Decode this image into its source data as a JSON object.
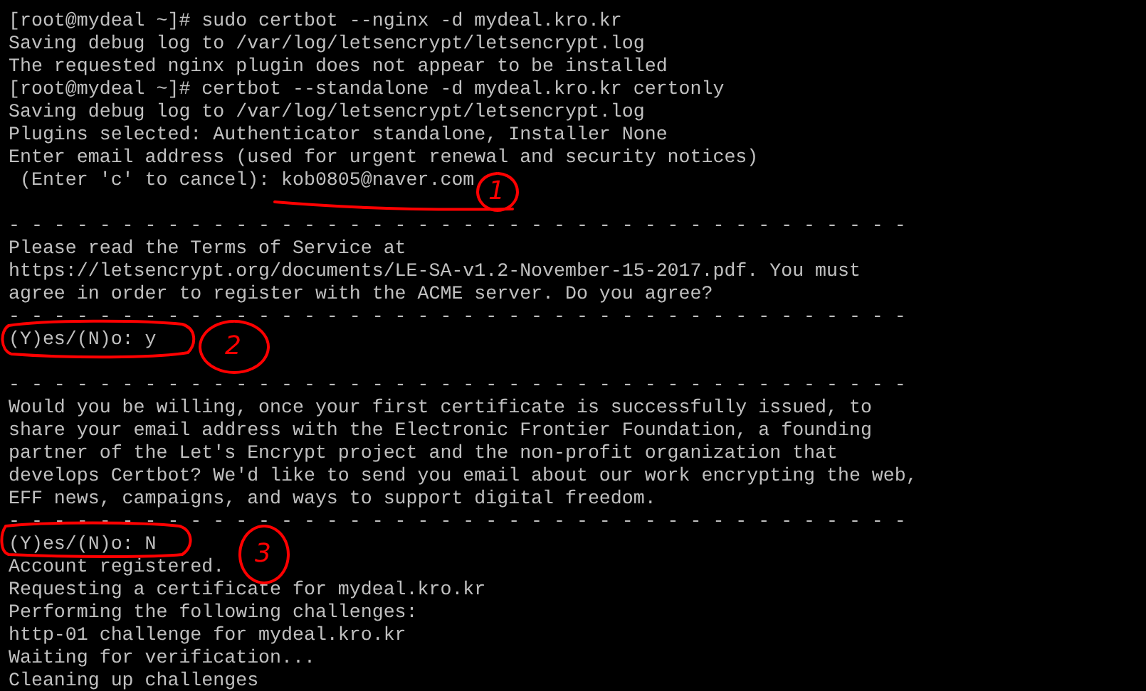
{
  "terminal": {
    "lines": [
      {
        "kind": "text",
        "text": "[root@mydeal ~]# sudo certbot --nginx -d mydeal.kro.kr"
      },
      {
        "kind": "text",
        "text": "Saving debug log to /var/log/letsencrypt/letsencrypt.log"
      },
      {
        "kind": "text",
        "text": "The requested nginx plugin does not appear to be installed"
      },
      {
        "kind": "text",
        "text": "[root@mydeal ~]# certbot --standalone -d mydeal.kro.kr certonly"
      },
      {
        "kind": "text",
        "text": "Saving debug log to /var/log/letsencrypt/letsencrypt.log"
      },
      {
        "kind": "text",
        "text": "Plugins selected: Authenticator standalone, Installer None"
      },
      {
        "kind": "text",
        "text": "Enter email address (used for urgent renewal and security notices)"
      },
      {
        "kind": "text",
        "text": " (Enter 'c' to cancel): kob0805@naver.com"
      },
      {
        "kind": "blank"
      },
      {
        "kind": "text",
        "text": "- - - - - - - - - - - - - - - - - - - - - - - - - - - - - - - - - - - - - - - -"
      },
      {
        "kind": "text",
        "text": "Please read the Terms of Service at"
      },
      {
        "kind": "text",
        "text": "https://letsencrypt.org/documents/LE-SA-v1.2-November-15-2017.pdf. You must"
      },
      {
        "kind": "text",
        "text": "agree in order to register with the ACME server. Do you agree?"
      },
      {
        "kind": "text",
        "text": "- - - - - - - - - - - - - - - - - - - - - - - - - - - - - - - - - - - - - - - -"
      },
      {
        "kind": "text",
        "text": "(Y)es/(N)o: y"
      },
      {
        "kind": "blank"
      },
      {
        "kind": "text",
        "text": "- - - - - - - - - - - - - - - - - - - - - - - - - - - - - - - - - - - - - - - -"
      },
      {
        "kind": "text",
        "text": "Would you be willing, once your first certificate is successfully issued, to"
      },
      {
        "kind": "text",
        "text": "share your email address with the Electronic Frontier Foundation, a founding"
      },
      {
        "kind": "text",
        "text": "partner of the Let's Encrypt project and the non-profit organization that"
      },
      {
        "kind": "text",
        "text": "develops Certbot? We'd like to send you email about our work encrypting the web,"
      },
      {
        "kind": "text",
        "text": "EFF news, campaigns, and ways to support digital freedom."
      },
      {
        "kind": "text",
        "text": "- - - - - - - - - - - - - - - - - - - - - - - - - - - - - - - - - - - - - - - -"
      },
      {
        "kind": "text",
        "text": "(Y)es/(N)o: N"
      },
      {
        "kind": "text",
        "text": "Account registered."
      },
      {
        "kind": "text",
        "text": "Requesting a certificate for mydeal.kro.kr"
      },
      {
        "kind": "text",
        "text": "Performing the following challenges:"
      },
      {
        "kind": "text",
        "text": "http-01 challenge for mydeal.kro.kr"
      },
      {
        "kind": "text",
        "text": "Waiting for verification..."
      },
      {
        "kind": "text",
        "text": "Cleaning up challenges"
      }
    ]
  },
  "annotations": [
    {
      "label": "1"
    },
    {
      "label": "2"
    },
    {
      "label": "3"
    }
  ]
}
